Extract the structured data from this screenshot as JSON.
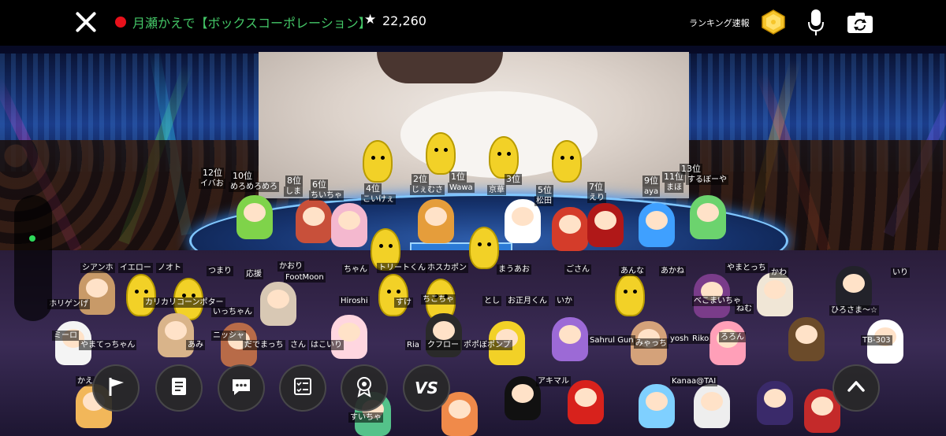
{
  "header": {
    "title": "月瀬かえで【ボックスコーポレーション】",
    "star_symbol": "★",
    "star_count": "22,260",
    "ranking_label": "ランキング速報"
  },
  "colors": {
    "live_dot": "#e8111b",
    "title": "#44c767",
    "side_indicator": "#2ed85a"
  },
  "icons": {
    "close": "close-icon",
    "ranking": "ranking-badge-icon",
    "mic": "microphone-icon",
    "camera": "camera-switch-icon",
    "flag": "flag-icon",
    "document": "document-icon",
    "chat": "chat-bubble-icon",
    "list": "checklist-icon",
    "badge": "award-badge-icon",
    "vs": "vs-icon",
    "up": "chevron-up-icon"
  },
  "stage": {
    "ranks": [
      {
        "rank": "12位",
        "name": "イバお"
      },
      {
        "rank": "10位",
        "name": "めろめろめろ"
      },
      {
        "rank": "8位",
        "name": "しま"
      },
      {
        "rank": "6位",
        "name": "ちいちゃ"
      },
      {
        "rank": "4位",
        "name": "こいけぇ"
      },
      {
        "rank": "2位",
        "name": "じぇむさ"
      },
      {
        "rank": "1位",
        "name": "Wawa"
      },
      {
        "rank": "3位",
        "name": "京華"
      },
      {
        "rank": "5位",
        "name": "松田"
      },
      {
        "rank": "7位",
        "name": "えり"
      },
      {
        "rank": "9位",
        "name": "aya"
      },
      {
        "rank": "11位",
        "name": "まほ"
      },
      {
        "rank": "13位",
        "name": "するぼーや"
      }
    ],
    "viewer_names": [
      "シアンホ",
      "イエロー",
      "ノオト",
      "つまり",
      "応援",
      "かおり",
      "ちゃん",
      "FootMoon",
      "トリートくん",
      "ホスカポン",
      "まうあお",
      "ごさん",
      "あんな",
      "あかね",
      "やまとっち",
      "かわ",
      "いり",
      "ホリゲンげ",
      "カリカリコーンポター",
      "いっちゃん",
      "Hiroshi",
      "すけ",
      "ちこちゃ",
      "とし",
      "お正月くん",
      "いか",
      "ねむ",
      "べこまいちゃ",
      "ひろさま～☆",
      "ミーロ",
      "やまてっちゃん",
      "あみ",
      "ニッシャ",
      "だでまっち",
      "さん",
      "はこいり",
      "Ria",
      "クフロー",
      "ポポぼポンプ",
      "Sahrul Gun",
      "みゃっち",
      "yosh",
      "Riko",
      "ろろん",
      "TB-303",
      "かえ",
      "アキマル",
      "Kanaa@TAI",
      "すいちゃ"
    ]
  }
}
